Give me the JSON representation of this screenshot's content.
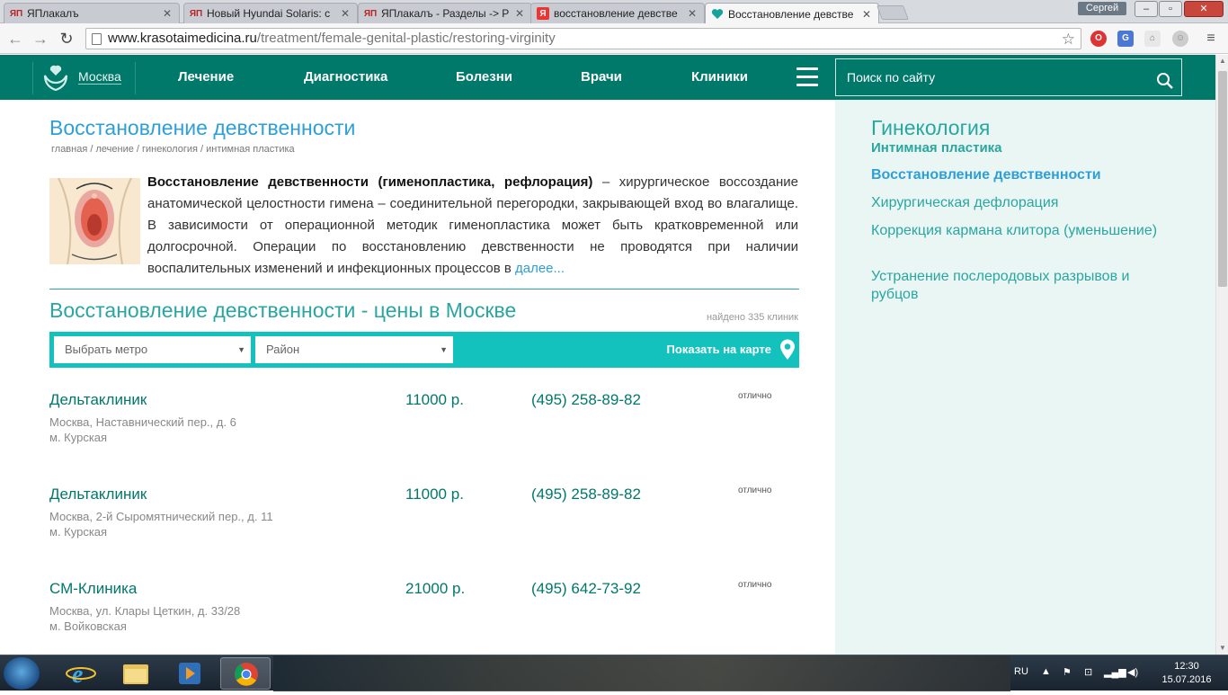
{
  "browser": {
    "tabs": [
      {
        "label": "ЯПлакалъ",
        "favicon": "yaplakal"
      },
      {
        "label": "Новый Hyundai Solaris: с",
        "favicon": "yaplakal"
      },
      {
        "label": "ЯПлакалъ - Разделы -> Р",
        "favicon": "yaplakal"
      },
      {
        "label": "восстановление девстве",
        "favicon": "yandex"
      },
      {
        "label": "Восстановление девстве",
        "favicon": "heart",
        "active": true
      }
    ],
    "user": "Сергей",
    "url_host": "www.krasotaimedicina.ru",
    "url_path": "/treatment/female-genital-plastic/restoring-virginity"
  },
  "header": {
    "city": "Москва",
    "nav": [
      "Лечение",
      "Диагностика",
      "Болезни",
      "Врачи",
      "Клиники"
    ],
    "search_placeholder": "Поиск по сайту"
  },
  "article": {
    "title": "Восстановление девственности",
    "breadcrumb": [
      "главная",
      "лечение",
      "гинекология",
      "интимная пластика"
    ],
    "intro_bold": "Восстановление девственности (гименопластика, рефлорация)",
    "intro_text": " – хирургическое воссоздание анатомической целостности гимена – соединительной перегородки, закрывающей вход во влагалище. В зависимости от операционной методик гименопластика может быть кратковременной или долгосрочной. Операции по восстановлению девственности не проводятся при наличии воспалительных изменений и инфекционных процессов в",
    "more": "далее..."
  },
  "prices": {
    "title": "Восстановление девственности - цены в Москве",
    "found": "найдено 335 клиник",
    "metro_select": "Выбрать метро",
    "district_select": "Район",
    "map_link": "Показать на карте",
    "clinics": [
      {
        "name": "Дельтаклиник",
        "address": "Москва, Наставнический пер., д. 6",
        "metro": "м. Курская",
        "price": "11000 р.",
        "phone": "(495) 258-89-82",
        "rating": "отлично"
      },
      {
        "name": "Дельтаклиник",
        "address": "Москва, 2-й Сыромятнический пер., д. 11",
        "metro": "м. Курская",
        "price": "11000 р.",
        "phone": "(495) 258-89-82",
        "rating": "отлично"
      },
      {
        "name": "СМ-Клиника",
        "address": "Москва, ул. Клары Цеткин, д. 33/28",
        "metro": "м. Войковская",
        "price": "21000 р.",
        "phone": "(495) 642-73-92",
        "rating": "отлично"
      }
    ]
  },
  "sidebar": {
    "title": "Гинекология",
    "subtitle": "Интимная пластика",
    "links": [
      {
        "label": "Восстановление девственности",
        "active": true
      },
      {
        "label": "Хирургическая дефлорация"
      },
      {
        "label": "Коррекция кармана клитора (уменьшение)"
      },
      {
        "label": "Устранение послеродовых разрывов и рубцов"
      }
    ]
  },
  "taskbar": {
    "lang": "RU",
    "time": "12:30",
    "date": "15.07.2016"
  },
  "colors": {
    "brand": "#00786a",
    "accent": "#2aa6a0",
    "link": "#2e9fd8",
    "filter": "#13c2bd"
  }
}
